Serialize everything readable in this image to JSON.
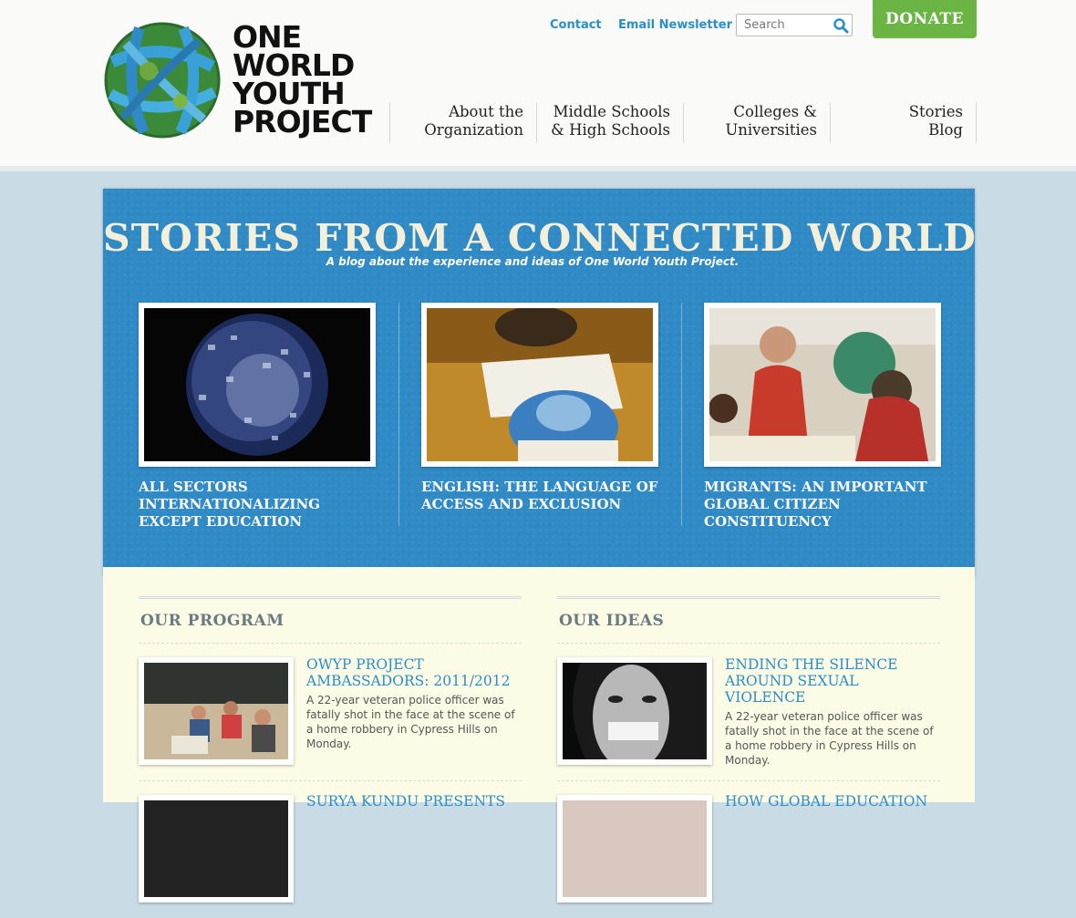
{
  "header": {
    "logo_lines": [
      "One",
      "World",
      "Youth",
      "Project"
    ],
    "links": {
      "contact": "Contact",
      "newsletter": "Email Newsletter"
    },
    "search": {
      "placeholder": "Search"
    },
    "donate": "DONATE",
    "nav": [
      {
        "line1": "About the",
        "line2": "Organization"
      },
      {
        "line1": "Middle Schools",
        "line2": "& High Schools"
      },
      {
        "line1": "Colleges &",
        "line2": "Universities"
      },
      {
        "line1": "Stories",
        "line2": "Blog"
      }
    ]
  },
  "feature": {
    "title": "STORIES FROM A CONNECTED WORLD",
    "subtitle": "A blog about the experience and ideas of One World Youth Project.",
    "stories": [
      {
        "caption": "All Sectors Internationalizing Except Education"
      },
      {
        "caption": "English: The Language of Access and Exclusion"
      },
      {
        "caption": "Migrants: An Important Global Citizen Constituency"
      }
    ]
  },
  "program": {
    "title": "Our Program",
    "posts": [
      {
        "title": "OWYP Project Ambassadors: 2011/2012",
        "excerpt": "A 22-year veteran police officer was fatally shot in the face at the scene of a home robbery in Cypress Hills on Monday."
      },
      {
        "title": "Surya Kundu Presents",
        "excerpt": ""
      }
    ]
  },
  "ideas": {
    "title": "Our Ideas",
    "posts": [
      {
        "title": "Ending the Silence Around Sexual Violence",
        "excerpt": "A 22-year veteran police officer was fatally shot in the face at the scene of a home robbery in Cypress Hills on Monday."
      },
      {
        "title": "How Global Education",
        "excerpt": ""
      }
    ]
  },
  "colors": {
    "blue": "#2f8ac5",
    "green": "#6bb545",
    "link": "#2a8ec8",
    "cream": "#fbfbe6"
  }
}
